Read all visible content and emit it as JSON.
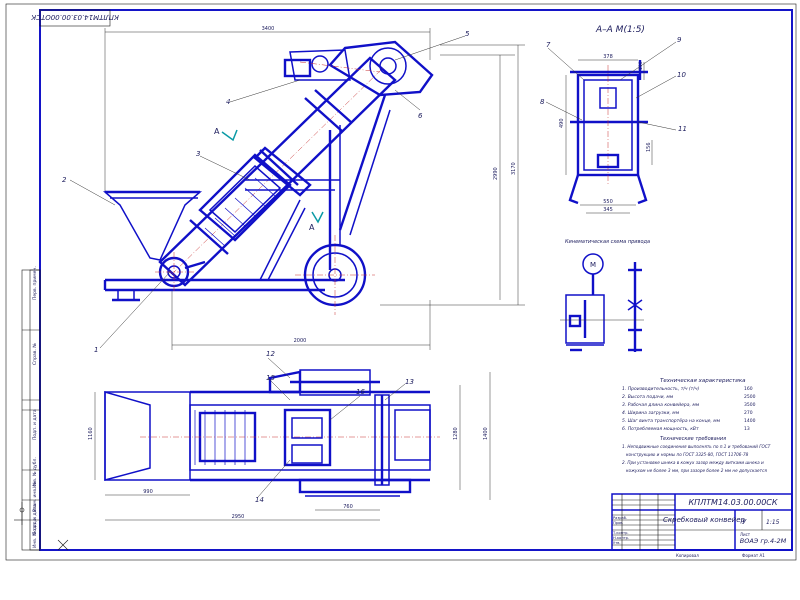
{
  "sheet": {
    "stamp_code": "КПЛТМ14.03.00.00ОТСК",
    "stamp_mirror": "КПЛТМ14.03.00.00ОТСК"
  },
  "section": {
    "title": "А–А  М(1:5)"
  },
  "kinematic": {
    "title": "Кинематическая схема привода",
    "motor_label": "М"
  },
  "callouts": {
    "c1": "1",
    "c2": "2",
    "c3": "3",
    "c4": "4",
    "c5": "5",
    "c6": "6",
    "c7": "7",
    "c8": "8",
    "c9": "9",
    "c10": "10",
    "c11": "11",
    "c12": "12",
    "c13": "13",
    "c14": "14",
    "c15": "15",
    "c16": "16",
    "sectionA1": "А",
    "sectionA2": "А"
  },
  "dims": {
    "side_top": "3400",
    "side_height1": "2990",
    "side_height2": "3170",
    "side_base": "2000",
    "plan_width1": "1160",
    "plan_width2": "1280",
    "plan_depth": "1400",
    "plan_small": "990",
    "plan_total": "2950",
    "plan_bottom": "760",
    "sec_top": "378",
    "sec_h": "490",
    "sec_r1": "156",
    "sec_b1": "550",
    "sec_b2": "345",
    "sec_small": "190"
  },
  "specs": {
    "title": "Техническая характеристика",
    "rows": [
      {
        "label": "1. Производительность, т/ч (т/ч)",
        "value": "160"
      },
      {
        "label": "2. Высота подачи, мм",
        "value": "2500"
      },
      {
        "label": "3. Рабочая длина конвейера, мм",
        "value": "3500"
      },
      {
        "label": "4. Ширина загрузки, мм",
        "value": "270"
      },
      {
        "label": "5. Шаг винта транспортёра на конце, мм",
        "value": "1400"
      },
      {
        "label": "6. Потребляемая мощность, кВт",
        "value": "13"
      }
    ]
  },
  "notes": {
    "title": "Технические требования",
    "lines": [
      "1. Неподвижные соединения выполнять по п.1 и требований ГОСТ",
      "конструкцию и нормы по ГОСТ 3325-80, ГОСТ 11706-78",
      "2. При установке шнека в кожух зазор между витками шнека и",
      "кожухом не более 3 мм, при зазоре более 2 мм не допускается"
    ]
  },
  "title_block": {
    "code": "КПЛТМ14.03.00.00СК",
    "name": "Скребковый конвейер",
    "stage": "У",
    "scale": "1:15",
    "org": "ВОАЭ гр.4-2М",
    "sheet_label": "Лист",
    "format_label": "Формат  А1",
    "copy_label": "Копировал",
    "roles": [
      "Разраб.",
      "Пров.",
      "Т.контр.",
      "Н.контр.",
      "Утв."
    ]
  },
  "left_strip": {
    "cells": [
      "Перв. примен.",
      "Справ. №",
      "Подп. и дата",
      "Инв. № дубл.",
      "Взам. инв. №",
      "Подп. и дата",
      "Инв. № подл."
    ]
  },
  "colors": {
    "frame": "#1414c8",
    "drawing": "#1010c8",
    "accent": "#0a9aa5"
  }
}
